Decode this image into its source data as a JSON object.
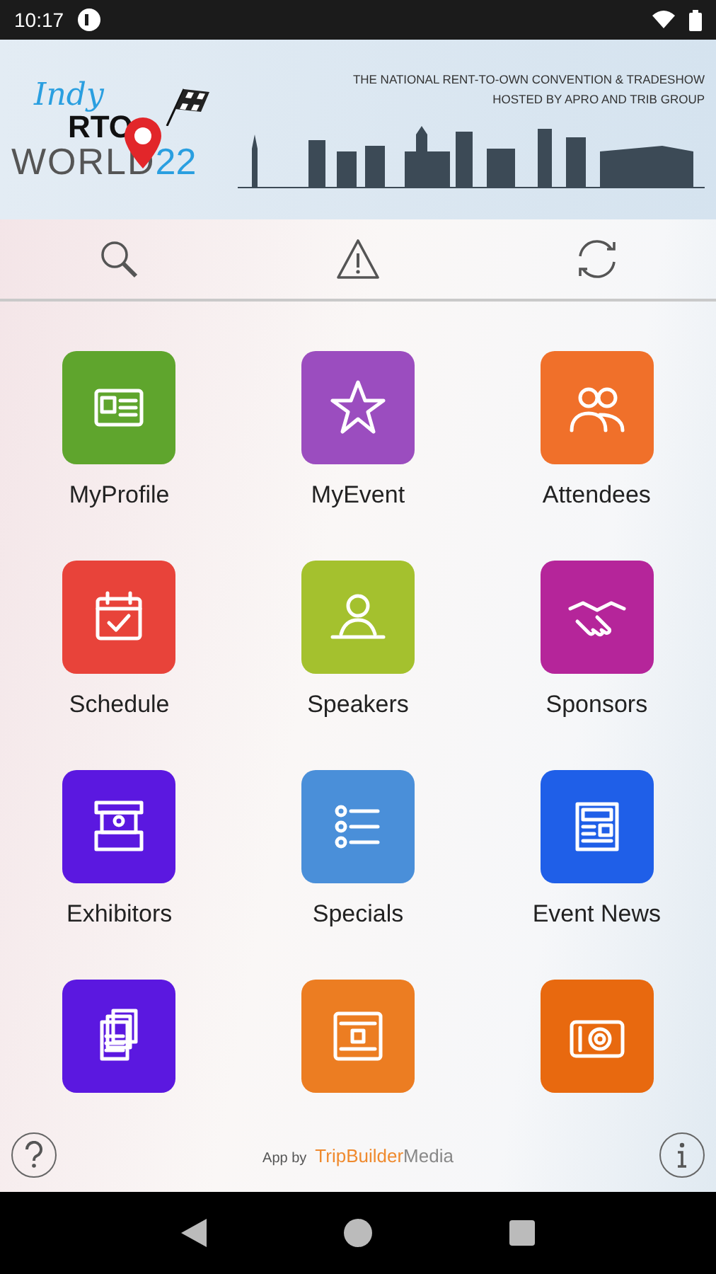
{
  "status_bar": {
    "time": "10:17"
  },
  "banner": {
    "logo_top": "Indy",
    "logo_mid": "RTO",
    "logo_word": "WORLD",
    "logo_year": "22",
    "tagline": "THE NATIONAL RENT-TO-OWN CONVENTION & TRADESHOW",
    "hosted": "HOSTED BY APRO AND TRIB GROUP"
  },
  "tiles": [
    {
      "label": "MyProfile",
      "color": "#5fa52d"
    },
    {
      "label": "MyEvent",
      "color": "#9b4dbf"
    },
    {
      "label": "Attendees",
      "color": "#f0702a"
    },
    {
      "label": "Schedule",
      "color": "#e8433a"
    },
    {
      "label": "Speakers",
      "color": "#a4c12e"
    },
    {
      "label": "Sponsors",
      "color": "#b5259a"
    },
    {
      "label": "Exhibitors",
      "color": "#5b18e0"
    },
    {
      "label": "Specials",
      "color": "#4a8fd9"
    },
    {
      "label": "Event News",
      "color": "#1f5fe8"
    },
    {
      "color": "#5b18e0"
    },
    {
      "color": "#ec7d22"
    },
    {
      "color": "#e8690f"
    }
  ],
  "footer": {
    "prefix": "App by",
    "brand_a": "TripBuilder",
    "brand_b": "Media"
  }
}
